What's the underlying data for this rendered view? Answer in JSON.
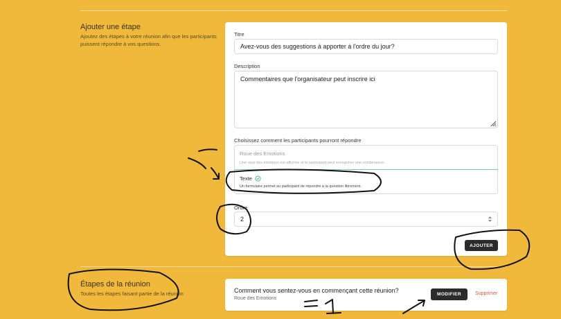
{
  "add_step": {
    "title": "Ajouter une étape",
    "description": "Ajoutez des étapes à votre réunion afin que les participants puissent répondre à vos questions."
  },
  "form": {
    "title_label": "Titre",
    "title_value": "Avez-vous des suggestions à apporter à l'ordre du jour?",
    "description_label": "Description",
    "description_value": "Commentaires que l'organisateur peut inscrire ici",
    "choice_label": "Choisissez comment les participants pourront répondre",
    "options": [
      {
        "title": "Roue des Emotions",
        "description": "Une roue des émotions est affichée et le participant peut enregistrer une combinaison.",
        "selected": false
      },
      {
        "title": "Texte",
        "description": "Un formulaire permet au participant de répondre à la question librement.",
        "selected": true
      }
    ],
    "order_label": "Ordre",
    "order_value": "2",
    "add_button": "AJOUTER"
  },
  "steps": {
    "title": "Étapes de la réunion",
    "description": "Toutes les étapes faisant partie de la réunion",
    "items": [
      {
        "question": "Comment vous sentez-vous en commençant cette réunion?",
        "type": "Roue des Emotions",
        "edit_label": "MODIFIER",
        "delete_label": "Supprimer"
      }
    ]
  },
  "colors": {
    "background": "#f0b93b",
    "accent_green": "#7ec9a0",
    "danger": "#e05a3a",
    "button": "#2b2b2b"
  },
  "icons": {
    "selected": "check-circle-icon",
    "resize": "resize-handle-icon",
    "stepper": "stepper-arrows-icon"
  }
}
